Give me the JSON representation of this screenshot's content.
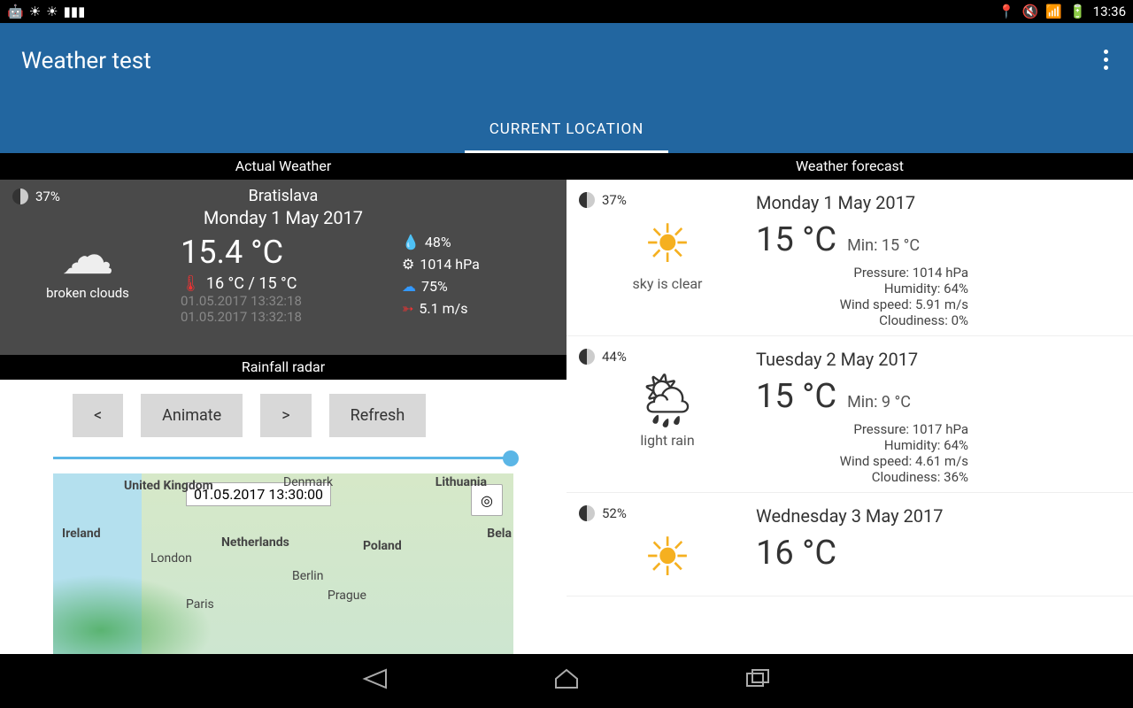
{
  "status": {
    "time": "13:36"
  },
  "header": {
    "title": "Weather test",
    "tab": "CURRENT LOCATION"
  },
  "sections": {
    "actual": "Actual Weather",
    "forecast": "Weather forecast",
    "radar": "Rainfall radar"
  },
  "actual": {
    "moon_pct": "37%",
    "city": "Bratislava",
    "date": "Monday 1 May 2017",
    "temp": "15.4 °C",
    "minmax": "16 °C / 15 °C",
    "ts1": "01.05.2017 13:32:18",
    "ts2": "01.05.2017 13:32:18",
    "condition": "broken clouds",
    "humidity": "48%",
    "pressure": "1014 hPa",
    "cloud": "75%",
    "wind": "5.1 m/s"
  },
  "radar": {
    "prev": "<",
    "animate": "Animate",
    "next": ">",
    "refresh": "Refresh",
    "map_time": "01.05.2017 13:30:00",
    "labels": {
      "uk": "United Kingdom",
      "ireland": "Ireland",
      "denmark": "Denmark",
      "lithuania": "Lithuania",
      "london": "London",
      "netherlands": "Netherlands",
      "poland": "Poland",
      "bela": "Bela",
      "berlin": "Berlin",
      "prague": "Prague",
      "paris": "Paris"
    }
  },
  "forecast": [
    {
      "moon": "37%",
      "condition": "sky is clear",
      "date": "Monday 1 May 2017",
      "temp": "15 °C",
      "min": "Min: 15 °C",
      "pressure": "Pressure:  1014 hPa",
      "humidity": "Humidity:  64%",
      "wind": "Wind speed:  5.91 m/s",
      "cloud": "Cloudiness:  0%"
    },
    {
      "moon": "44%",
      "condition": "light rain",
      "date": "Tuesday 2 May 2017",
      "temp": "15 °C",
      "min": "Min: 9 °C",
      "pressure": "Pressure:  1017 hPa",
      "humidity": "Humidity:  64%",
      "wind": "Wind speed:  4.61 m/s",
      "cloud": "Cloudiness:  36%"
    },
    {
      "moon": "52%",
      "condition": "",
      "date": "Wednesday 3 May 2017",
      "temp": "16 °C",
      "min": "",
      "pressure": "",
      "humidity": "",
      "wind": "",
      "cloud": ""
    }
  ]
}
